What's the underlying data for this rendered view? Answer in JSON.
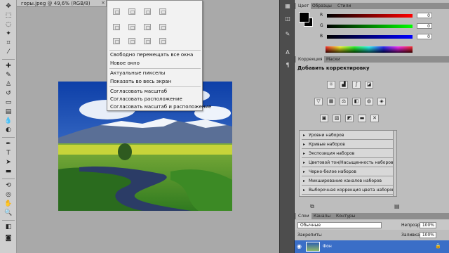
{
  "document": {
    "tab_label": "горы.jpeg @ 49,6% (RGB/8)",
    "tab_close": "×"
  },
  "view_menu": {
    "items": [
      "Свободно перемещать все окна",
      "Новое окно",
      "Актуальные пикселы",
      "Показать во весь экран",
      "Согласовать масштаб",
      "Согласовать расположение",
      "Согласовать масштаб и расположение"
    ]
  },
  "color_panel": {
    "tabs": [
      "Цвет",
      "Образцы",
      "Стили"
    ],
    "channels": [
      {
        "label": "R",
        "value": "0"
      },
      {
        "label": "G",
        "value": "0"
      },
      {
        "label": "B",
        "value": "0"
      }
    ]
  },
  "adjustments_panel": {
    "tabs": [
      "Коррекция",
      "Маски"
    ],
    "title": "Добавить корректировку",
    "presets": [
      "Уровни наборов",
      "Кривые наборов",
      "Экспозиция наборов",
      "Цветовой тон/Насыщенность наборов",
      "Черно-белое наборов",
      "Микширование каналов наборов",
      "Выборочная коррекция цвета наборов"
    ]
  },
  "layers_panel": {
    "tabs": [
      "Слои",
      "Каналы",
      "Контуры"
    ],
    "blend_mode": "Обычные",
    "opacity_label": "Непрозр.:",
    "opacity_value": "100%",
    "fill_label": "Заливка:",
    "fill_value": "100%",
    "lock_label": "Закрепить:",
    "layer_name": "Фон"
  },
  "colors": {
    "accent_layer": "#3a6ec7",
    "foreground": "#000000",
    "background": "#000000"
  }
}
